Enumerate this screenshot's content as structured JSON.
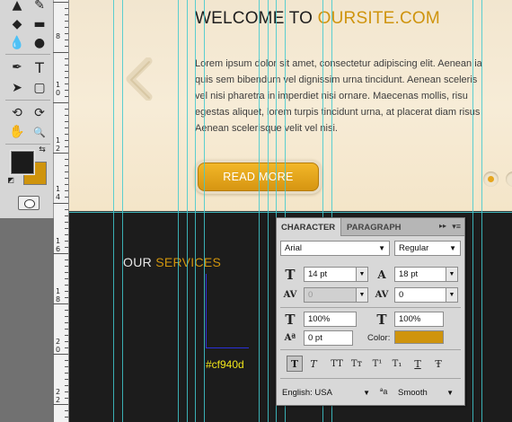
{
  "tools": {
    "items": [
      {
        "name": "stamp-tool-icon",
        "glyph": "▲"
      },
      {
        "name": "history-brush-icon",
        "glyph": "✎"
      },
      {
        "name": "eraser-icon",
        "glyph": "◆"
      },
      {
        "name": "gradient-icon",
        "glyph": "▬"
      },
      {
        "name": "blur-icon",
        "glyph": "💧"
      },
      {
        "name": "dodge-icon",
        "glyph": "●"
      },
      {
        "name": "pen-tool-icon",
        "glyph": "✒"
      },
      {
        "name": "type-tool-icon",
        "glyph": "T"
      },
      {
        "name": "path-selection-icon",
        "glyph": "➤"
      },
      {
        "name": "rectangle-tool-icon",
        "glyph": "▢"
      },
      {
        "name": "3d-rotate-icon",
        "glyph": "⟲"
      },
      {
        "name": "3d-orbit-icon",
        "glyph": "⟳"
      },
      {
        "name": "hand-tool-icon",
        "glyph": "✋"
      },
      {
        "name": "zoom-tool-icon",
        "glyph": "🔍"
      }
    ],
    "colors": {
      "foreground": "#1b1b1b",
      "background": "#cf940d"
    }
  },
  "ruler": {
    "labels": [
      "8",
      "1",
      "0",
      "1",
      "2",
      "1",
      "4",
      "1",
      "6",
      "1",
      "8",
      "2",
      "0",
      "2",
      "2"
    ]
  },
  "hero": {
    "welcome_prefix": "WELCOME TO ",
    "welcome_highlight": "OURSITE.COM",
    "lorem_lines": [
      "Lorem ipsum dolor sit amet, consectetur adipiscing elit. Aenean ia",
      "quis sem bibendum vel dignissim urna tincidunt. Aenean sceleris",
      "vel nisi pharetra in imperdiet nisi ornare. Maecenas mollis, risu",
      "egestas aliquet, lorem turpis tincidunt urna, at placerat diam risus",
      "Aenean scelerisque velit vel nisi."
    ],
    "read_more": "READ MORE"
  },
  "services": {
    "prefix": "OUR ",
    "highlight": "SERVICES",
    "annotation": "#cf940d"
  },
  "character_panel": {
    "tab_character": "CHARACTER",
    "tab_paragraph": "PARAGRAPH",
    "collapse_glyph": "▸▸",
    "menu_glyph": "▾≡",
    "font_family": "Arial",
    "font_style": "Regular",
    "font_size": "14 pt",
    "leading": "18 pt",
    "kerning": "0",
    "tracking": "0",
    "vertical_scale": "100%",
    "horizontal_scale": "100%",
    "baseline_shift": "0 pt",
    "color_label": "Color:",
    "color_value": "#cf940d",
    "style_buttons": [
      "T",
      "T",
      "TT",
      "Tт",
      "T¹",
      "T₁",
      "T",
      "Ŧ"
    ],
    "language": "English: USA",
    "antialias_icon": "ªa",
    "antialias": "Smooth"
  }
}
